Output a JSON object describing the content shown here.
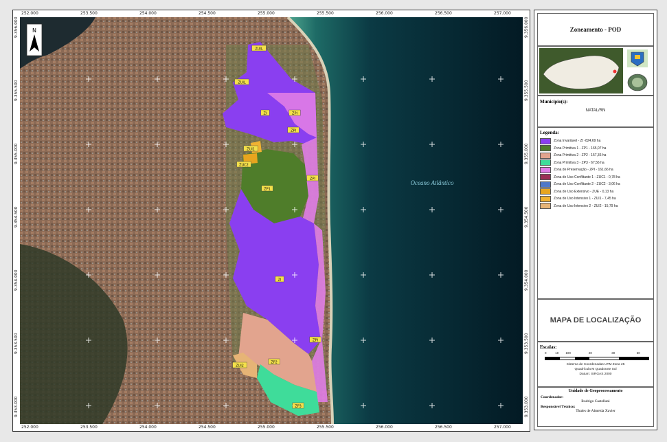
{
  "map": {
    "ocean_label": "Oceano Atlântico",
    "north_label": "N",
    "x_ticks": [
      "252.000",
      "253.500",
      "254.000",
      "254.500",
      "255.000",
      "255.500",
      "256.000",
      "256.500",
      "257.000"
    ],
    "y_ticks": [
      "9.356.000",
      "9.355.500",
      "9.355.000",
      "9.354.500",
      "9.354.000",
      "9.353.500",
      "9.353.000"
    ],
    "zone_labels": [
      "ZUIL",
      "ZUIL",
      "ZI",
      "ZPI",
      "ZPI",
      "ZUI1",
      "ZUC2",
      "ZP1",
      "ZPI",
      "ZI",
      "ZPI",
      "ZUI2",
      "ZP2",
      "ZP3"
    ],
    "colors": {
      "zi": "#8a3ff0",
      "zp1": "#4f7d2a",
      "zp2": "#e2a48e",
      "zp3": "#3fdc9a",
      "zpi": "#e07de6",
      "zuc1": "#9c2f57",
      "zuc2": "#4f78c8",
      "zue": "#e7a51f",
      "zui1": "#f0b232",
      "zui2": "#e6b476",
      "ocean_dark": "#031a24",
      "ocean_coast": "#2b8f7a",
      "land": "#8a6a55"
    }
  },
  "panel": {
    "title": "Zoneamento - POD",
    "municipio_label": "Município(s):",
    "municipio_value": "NATAL/RN",
    "legend_title": "Legenda:",
    "legend": [
      {
        "color": "#8a3ff0",
        "label": "Zona Invariável - ZI -824,69 ha"
      },
      {
        "color": "#4f7d2a",
        "label": "Zona Primitiva 1 - ZP1 - 165,07 ha"
      },
      {
        "color": "#e2a48e",
        "label": "Zona Primitiva 2 - ZP2 - 157,36 ha"
      },
      {
        "color": "#3fdc9a",
        "label": "Zona Primitiva 3 - ZP3 - 67,56 ha"
      },
      {
        "color": "#e07de6",
        "label": "Zona de Preservação - ZPI - 161,66 ha"
      },
      {
        "color": "#9c2f57",
        "label": "Zona de Uso Conflitante 1 - ZUC1 - 0,78 ha"
      },
      {
        "color": "#4f78c8",
        "label": "Zona de Uso Conflitante 2 - ZUC2 - 3,06 ha"
      },
      {
        "color": "#e7a51f",
        "label": "Zona de Uso Extensivo - ZUE - 0,13 ha"
      },
      {
        "color": "#f0b232",
        "label": "Zona de Uso Intensivo 1 - ZUI1 - 7,45 ha"
      },
      {
        "color": "#e6b476",
        "label": "Zona de Uso Intensivo 2 - ZUI2 - 15,79 ha"
      }
    ],
    "map_title": "MAPA DE LOCALIZAÇÃO",
    "scale_label": "Escalas:",
    "scale_ticks": [
      "0",
      "10",
      "100",
      "20",
      "30",
      "50"
    ],
    "projection": "Sistema de Coordenadas UTM Zona 25",
    "grid_line": "Quadrícula M  Quadrante Sul",
    "datum": "Datum: SIRGAS 2000",
    "unit": "Unidade de Geoprocessamento",
    "coordinator_label": "Coordenador:",
    "coordinator_name": "Rodrigo Castellani",
    "tech_label": "Responsável Técnico:",
    "tech_name": "Thales de Almeida Xavier"
  }
}
